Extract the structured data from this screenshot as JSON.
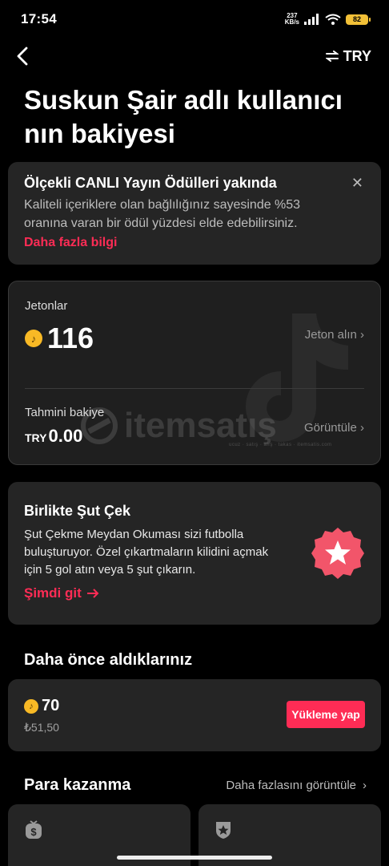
{
  "status_bar": {
    "time": "17:54",
    "net_speed": "237",
    "net_unit": "KB/s",
    "battery": "82"
  },
  "nav": {
    "currency": "TRY"
  },
  "title": "Suskun Şair adlı kullanıcı nın bakiyesi",
  "notice": {
    "title": "Ölçekli CANLI Yayın Ödülleri yakında",
    "body": "Kaliteli içeriklere olan bağlılığınız sayesinde %53 oranına varan bir ödül yüzdesi elde edebilirsiniz.",
    "link": "Daha fazla bilgi"
  },
  "balance": {
    "coins_label": "Jetonlar",
    "coins_value": "116",
    "get_coins": "Jeton alın",
    "estimated_label": "Tahmini bakiye",
    "currency_code": "TRY",
    "estimated_value": "0.00",
    "view": "Görüntüle"
  },
  "watermark": {
    "text": "itemsatış",
    "sub": "ucuz · satış · alış · takas · itemsatis.com"
  },
  "promo": {
    "title": "Birlikte Şut Çek",
    "body": "Şut Çekme Meydan Okuması sizi futbolla buluşturuyor. Özel çıkartmaların kilidini açmak için 5 gol atın veya 5 şut çıkarın.",
    "link": "Şimdi git"
  },
  "history": {
    "section_title": "Daha önce aldıklarınız",
    "coins": "70",
    "price": "₺51,50",
    "button": "Yükleme yap"
  },
  "earn": {
    "section_title": "Para kazanma",
    "more": "Daha fazlasını görüntüle"
  },
  "icons": {
    "back": "chevron-left-icon",
    "swap": "swap-arrows-icon",
    "close": "close-icon",
    "coin": "tiktok-coin-icon",
    "star": "star-badge-icon"
  },
  "colors": {
    "accent": "#fe2c55",
    "coin": "#f8b925",
    "card": "#252525"
  }
}
